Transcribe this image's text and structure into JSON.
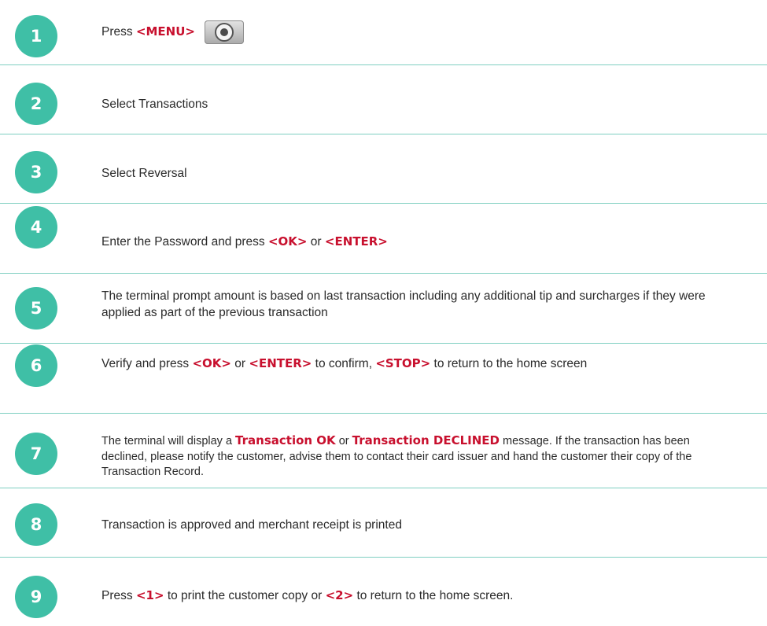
{
  "colors": {
    "badge": "#3fbfa6",
    "divider": "#7fcfc1",
    "keyword": "#c8102e",
    "text": "#2a2a2a"
  },
  "steps": [
    {
      "number": "1",
      "parts": [
        {
          "t": "Press "
        },
        {
          "t": "<MENU>",
          "k": true
        }
      ],
      "icon": "menu-button-icon"
    },
    {
      "number": "2",
      "parts": [
        {
          "t": "Select Transactions"
        }
      ]
    },
    {
      "number": "3",
      "parts": [
        {
          "t": "Select Reversal"
        }
      ]
    },
    {
      "number": "4",
      "parts": [
        {
          "t": "Enter the Password and press "
        },
        {
          "t": "<OK>",
          "k": true
        },
        {
          "t": " or "
        },
        {
          "t": "<ENTER>",
          "k": true
        }
      ]
    },
    {
      "number": "5",
      "parts": [
        {
          "t": "The terminal prompt amount is based on last transaction including any additional tip and surcharges if they were applied as part of the previous transaction"
        }
      ]
    },
    {
      "number": "6",
      "parts": [
        {
          "t": " Verify and press "
        },
        {
          "t": "<OK>",
          "k": true
        },
        {
          "t": " or "
        },
        {
          "t": "<ENTER>",
          "k": true
        },
        {
          "t": " to confirm, "
        },
        {
          "t": "<STOP>",
          "k": true
        },
        {
          "t": " to return to the home screen"
        }
      ]
    },
    {
      "number": "7",
      "small": true,
      "parts": [
        {
          "t": "The terminal will display a "
        },
        {
          "t": "Transaction OK",
          "k": true
        },
        {
          "t": " or "
        },
        {
          "t": "Transaction DECLINED",
          "k": true
        },
        {
          "t": " message. If the transaction has been declined, please notify the customer, advise them to contact their card issuer and hand the customer their copy of the Transaction Record."
        }
      ]
    },
    {
      "number": "8",
      "parts": [
        {
          "t": "Transaction is approved and merchant receipt is printed"
        }
      ]
    },
    {
      "number": "9",
      "parts": [
        {
          "t": " Press "
        },
        {
          "t": "<1>",
          "k": true
        },
        {
          "t": " to print the customer copy or "
        },
        {
          "t": "<2>",
          "k": true
        },
        {
          "t": " to return to the home screen."
        }
      ]
    }
  ]
}
